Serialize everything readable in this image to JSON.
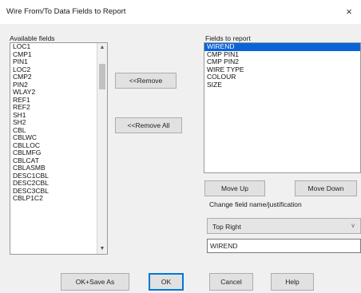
{
  "window": {
    "title": "Wire From/To Data Fields to Report",
    "close_glyph": "×"
  },
  "available": {
    "label": "Available fields",
    "items": [
      "LOC1",
      "CMP1",
      "PIN1",
      "LOC2",
      "CMP2",
      "PIN2",
      "WLAY2",
      "REF1",
      "REF2",
      "SH1",
      "SH2",
      "CBL",
      "CBLWC",
      "CBLLOC",
      "CBLMFG",
      "CBLCAT",
      "CBLASMB",
      "DESC1CBL",
      "DESC2CBL",
      "DESC3CBL",
      "CBLP1C2"
    ]
  },
  "report": {
    "label": "Fields to report",
    "items": [
      "WIREND",
      "CMP PIN1",
      "CMP PIN2",
      "WIRE TYPE",
      "COLOUR",
      "SIZE"
    ],
    "selected_index": 0
  },
  "buttons": {
    "remove": "<<Remove",
    "remove_all": "<<Remove All",
    "move_up": "Move Up",
    "move_down": "Move Down",
    "ok_save_as": "OK+Save As",
    "ok": "OK",
    "cancel": "Cancel",
    "help": "Help"
  },
  "change_label": "Change field name/justification",
  "justification": {
    "selected": "Top Right"
  },
  "field_name": {
    "value": "WIREND"
  }
}
